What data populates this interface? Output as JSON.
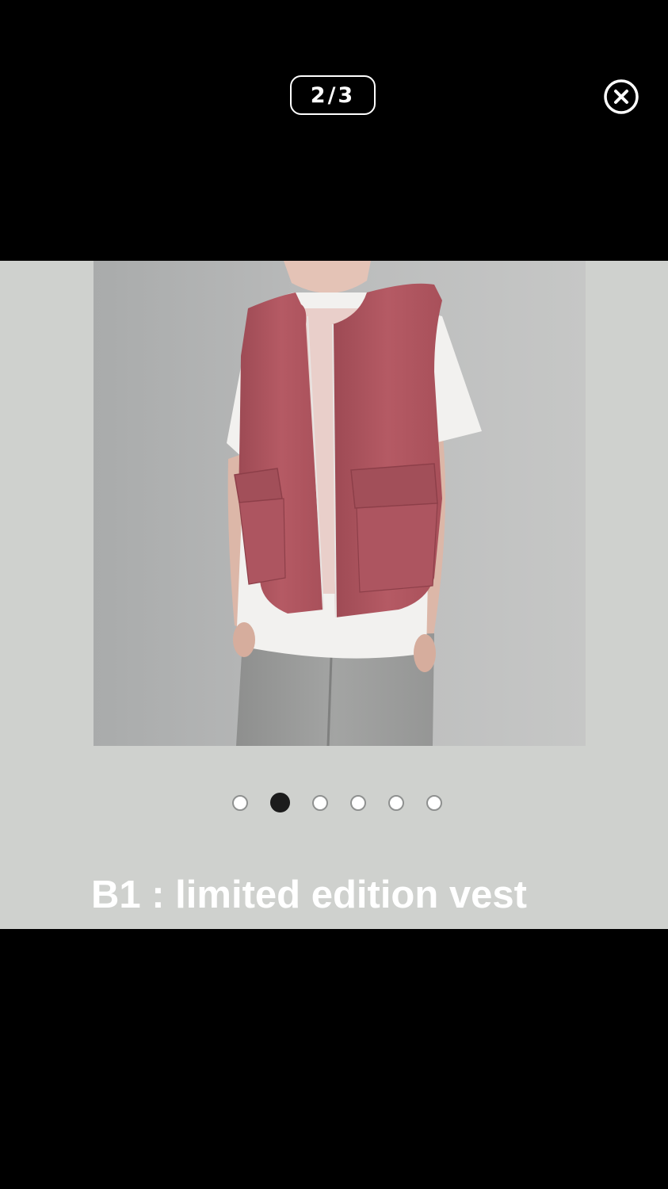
{
  "viewer": {
    "counter": "2/3",
    "close_icon": "close-circle-icon"
  },
  "slide": {
    "image": "photo of person wearing a red zip vest with flap pockets over a white t-shirt and grey sweatpants",
    "caption": "B1 : limited edition vest",
    "dots": {
      "count": 6,
      "active_index": 1
    }
  },
  "colors": {
    "background": "#000000",
    "slide_background": "#cfd1ce",
    "vest": "#b05760",
    "active_dot": "#1c1c1c"
  }
}
